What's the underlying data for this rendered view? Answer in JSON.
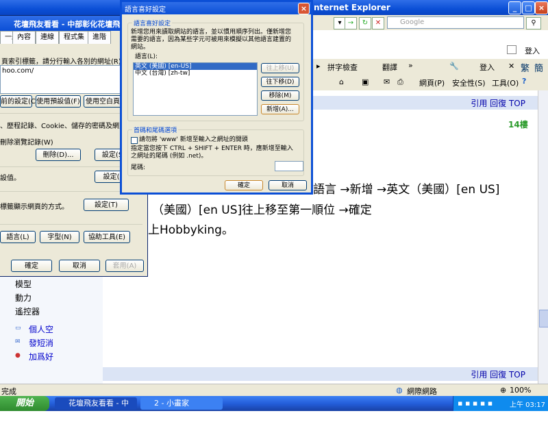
{
  "ie": {
    "title": "nternet Explorer",
    "search_placeholder": "Google",
    "toolbar2": [
      "拼字檢查",
      "翻譯",
      "登入",
      "繁",
      "簡"
    ],
    "toolbar3": [
      "網頁(P)",
      "安全性(S)",
      "工具(O)"
    ],
    "login": "登入"
  },
  "page": {
    "reply_links": "引用 回復 TOP",
    "floor": "14樓",
    "line1": "語言 →新增 →英文（美國）[en US]",
    "line2": "（美國）[en US]往上移至第一順位 →確定",
    "line3": "上Hobbyking。",
    "left_links": [
      "模型",
      "動力",
      "遙控器"
    ],
    "left_actions": [
      "個人空",
      "發短消",
      "加爲好"
    ]
  },
  "status": {
    "left": "完成",
    "zone": "網際網路",
    "zoom": "100%"
  },
  "taskbar": {
    "start": "開始",
    "items": [
      "花壇飛友看看 - 中部...",
      "2 - 小畫家"
    ],
    "clock": "上午 03:17"
  },
  "options_dialog": {
    "title": "花壇飛友看看 - 中部彰化花壇飛場",
    "tabs": [
      "一般",
      "內容",
      "連線",
      "程式集",
      "進階"
    ],
    "homepage_text": "頁索引標籤，請分行輸入各別的網址(R)",
    "homepage_url": "hoo.com/",
    "btn_current": "前的設定(C)",
    "btn_default": "使用預設值(F)",
    "btn_blank": "使用空白頁",
    "history_text": "、歷程記錄、Cookie、儲存的密碼及網頁表",
    "delete_check": "刪除瀏覽記錄(W)",
    "btn_delete": "刪除(D)...",
    "btn_settings1": "設定(S)",
    "search_text": "設值。",
    "btn_settings2": "設定(I)",
    "tabs_text": "標籤顯示網頁的方式。",
    "btn_settings3": "設定(T)",
    "btn_lang": "語言(L)",
    "btn_font": "字型(N)",
    "btn_access": "協助工具(E)",
    "btn_ok": "確定",
    "btn_cancel": "取消",
    "btn_apply": "套用(A)"
  },
  "lang_dialog": {
    "title": "語言喜好設定",
    "group1": "語言喜好設定",
    "desc": "新增您用來讀取網站的語言，並以慣用順序列出。僅新增您需要的語言，因為某些字元可被用來模擬以其他語言建置的網站。",
    "list_label": "語言(L):",
    "languages": [
      "英文 (美國) [en-US]",
      "中文 (台灣) [zh-tw]"
    ],
    "btn_up": "往上移(U)",
    "btn_down": "往下移(D)",
    "btn_remove": "移除(M)",
    "btn_add": "新增(A)...",
    "group2": "首碼和尾碼選項",
    "checkbox": "請勿將 'www' 新增至輸入之網址的開頭",
    "suffix_desc": "指定當您按下 CTRL + SHIFT + ENTER 時，應新增至輸入之網址的尾碼 (例如 .net)。",
    "suffix_label": "尾碼:",
    "btn_ok": "確定",
    "btn_cancel": "取消"
  }
}
